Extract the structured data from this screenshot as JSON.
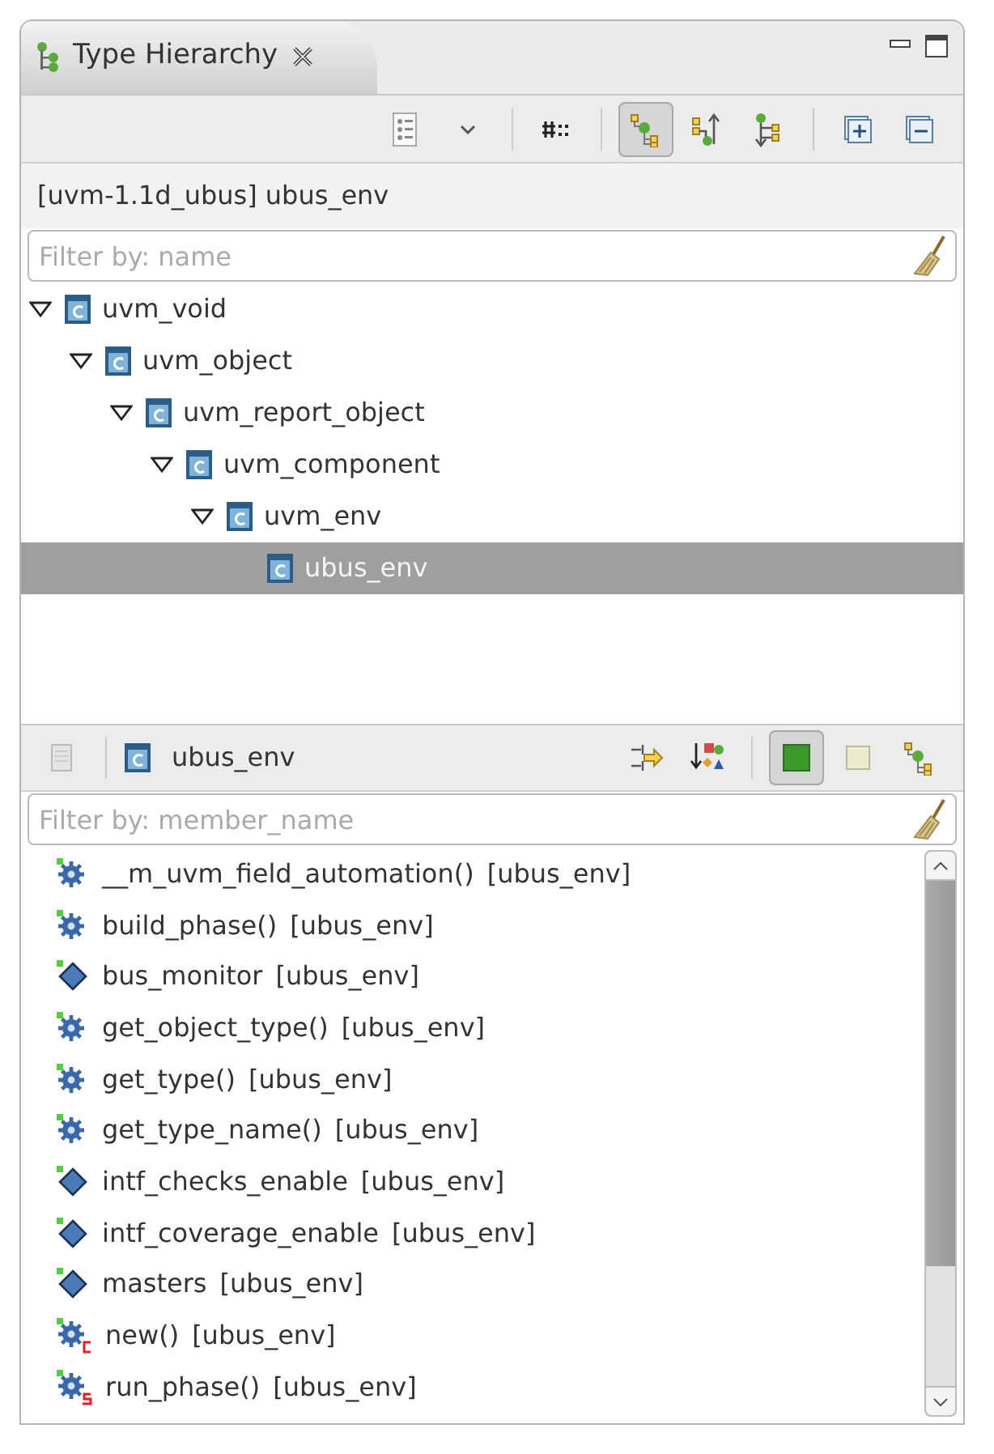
{
  "tab": {
    "title": "Type Hierarchy",
    "closable": true
  },
  "toolbar": [
    {
      "kind": "view-menu",
      "selected": false
    },
    {
      "kind": "dropdown",
      "selected": false
    },
    {
      "kind": "fields",
      "selected": false
    },
    {
      "kind": "hierarchy",
      "selected": true
    },
    {
      "kind": "supertypes",
      "selected": false
    },
    {
      "kind": "subtypes",
      "selected": false
    },
    {
      "kind": "expand",
      "selected": false
    },
    {
      "kind": "collapse",
      "selected": false
    }
  ],
  "header": "[uvm-1.1d_ubus] ubus_env",
  "type_filter": {
    "placeholder": "Filter by: name"
  },
  "tree": [
    {
      "label": "uvm_void",
      "expanded": true,
      "selected": false,
      "children": [
        {
          "label": "uvm_object",
          "expanded": true,
          "selected": false,
          "children": [
            {
              "label": "uvm_report_object",
              "expanded": true,
              "selected": false,
              "children": [
                {
                  "label": "uvm_component",
                  "expanded": true,
                  "selected": false,
                  "children": [
                    {
                      "label": "uvm_env",
                      "expanded": true,
                      "selected": false,
                      "children": [
                        {
                          "label": "ubus_env",
                          "selected": true
                        }
                      ]
                    }
                  ]
                }
              ]
            }
          ]
        }
      ]
    }
  ],
  "members_bar": {
    "type_name": "ubus_env",
    "buttons": [
      {
        "kind": "lock",
        "selected": false
      },
      {
        "kind": "sort-defining",
        "selected": false
      },
      {
        "kind": "sort-kind",
        "selected": false
      },
      {
        "kind": "inherited",
        "selected": true
      },
      {
        "kind": "plain",
        "selected": false
      },
      {
        "kind": "hierarchy",
        "selected": false
      }
    ]
  },
  "member_filter": {
    "placeholder": "Filter by: member_name"
  },
  "members": [
    {
      "kind": "method",
      "name": "__m_uvm_field_automation()",
      "owner": "[ubus_env]"
    },
    {
      "kind": "method",
      "name": "build_phase()",
      "owner": "[ubus_env]"
    },
    {
      "kind": "field",
      "name": "bus_monitor",
      "owner": "[ubus_env]"
    },
    {
      "kind": "method",
      "name": "get_object_type()",
      "owner": "[ubus_env]"
    },
    {
      "kind": "method",
      "name": "get_type()",
      "owner": "[ubus_env]"
    },
    {
      "kind": "method",
      "name": "get_type_name()",
      "owner": "[ubus_env]"
    },
    {
      "kind": "field",
      "name": "intf_checks_enable",
      "owner": "[ubus_env]"
    },
    {
      "kind": "field",
      "name": "intf_coverage_enable",
      "owner": "[ubus_env]"
    },
    {
      "kind": "field",
      "name": "masters",
      "owner": "[ubus_env]"
    },
    {
      "kind": "constructor",
      "name": "new()",
      "owner": "[ubus_env]"
    },
    {
      "kind": "task",
      "name": "run_phase()",
      "owner": "[ubus_env]"
    }
  ]
}
